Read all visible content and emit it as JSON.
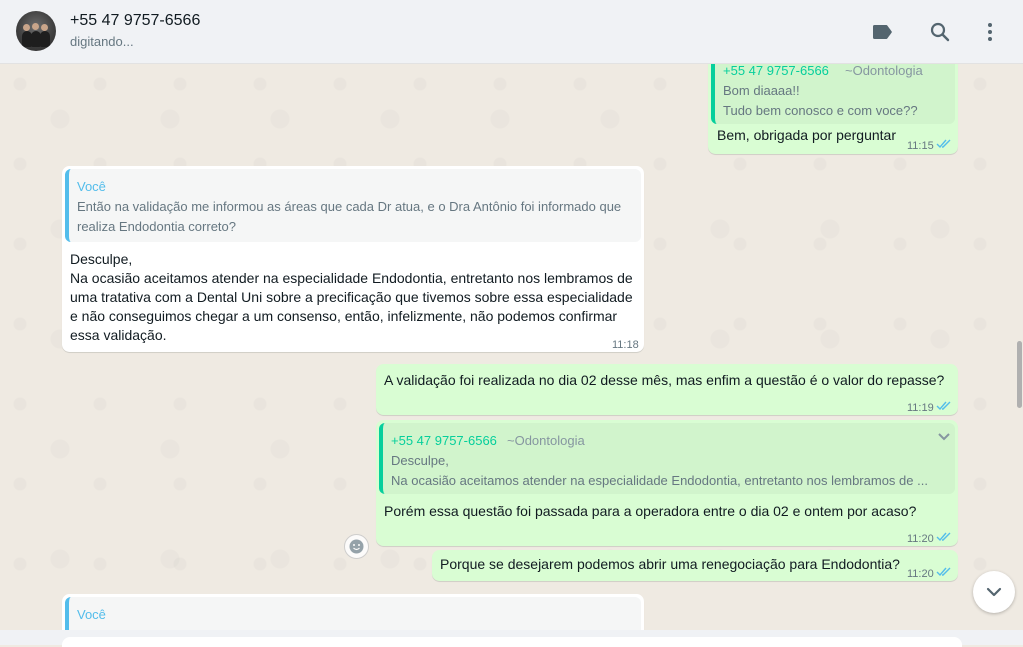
{
  "header": {
    "contact_name": "+55 47 9757-6566",
    "status": "digitando..."
  },
  "icons": {
    "label": "label-icon",
    "search": "search-icon",
    "menu": "menu-icon"
  },
  "messages": [
    {
      "id": "m1",
      "direction": "outgoing",
      "quote": {
        "author": "+55 47 9757-6566",
        "group": "~Odontologia",
        "text": "Bom diaaaa!!\nTudo bem conosco e com voce??"
      },
      "text": "Bem, obrigada por perguntar",
      "time": "11:15",
      "status": "read"
    },
    {
      "id": "m2",
      "direction": "incoming",
      "quote": {
        "author": "Você",
        "text": "Então na validação me informou as áreas que cada Dr atua, e o Dra Antônio foi informado que\nrealiza Endodontia correto?"
      },
      "text": "Desculpe,\nNa ocasião aceitamos atender na especialidade Endodontia, entretanto nos lembramos de\numa tratativa com a Dental Uni sobre a precificação que tivemos sobre essa especialidade\ne não conseguimos chegar a um consenso, então, infelizmente, não podemos confirmar\nessa validação.",
      "time": "11:18"
    },
    {
      "id": "m3",
      "direction": "outgoing",
      "text": "A validação foi realizada no dia 02 desse mês, mas enfim a questão é o valor do repasse?",
      "time": "11:19",
      "status": "read"
    },
    {
      "id": "m4",
      "direction": "outgoing",
      "quote": {
        "author": "+55 47 9757-6566",
        "group": "~Odontologia",
        "text": "Desculpe,\nNa ocasião aceitamos atender na especialidade Endodontia, entretanto nos lembramos de ..."
      },
      "text": "Porém essa questão foi passada para a operadora entre o dia 02 e ontem por acaso?",
      "time": "11:20",
      "status": "read"
    },
    {
      "id": "m5",
      "direction": "outgoing",
      "text": "Porque se desejarem podemos abrir uma renegociação para Endodontia?",
      "time": "11:20",
      "status": "read"
    },
    {
      "id": "m6",
      "direction": "incoming",
      "quote": {
        "author": "Você",
        "text": ""
      },
      "text": "",
      "time": ""
    }
  ],
  "colors": {
    "chat_background": "#efeae2",
    "outgoing_bubble": "#d9fdd3",
    "incoming_bubble": "#ffffff",
    "quote_in_bar": "#53bdeb",
    "quote_out_bar": "#06cf9c",
    "read_ticks": "#53bdeb"
  }
}
